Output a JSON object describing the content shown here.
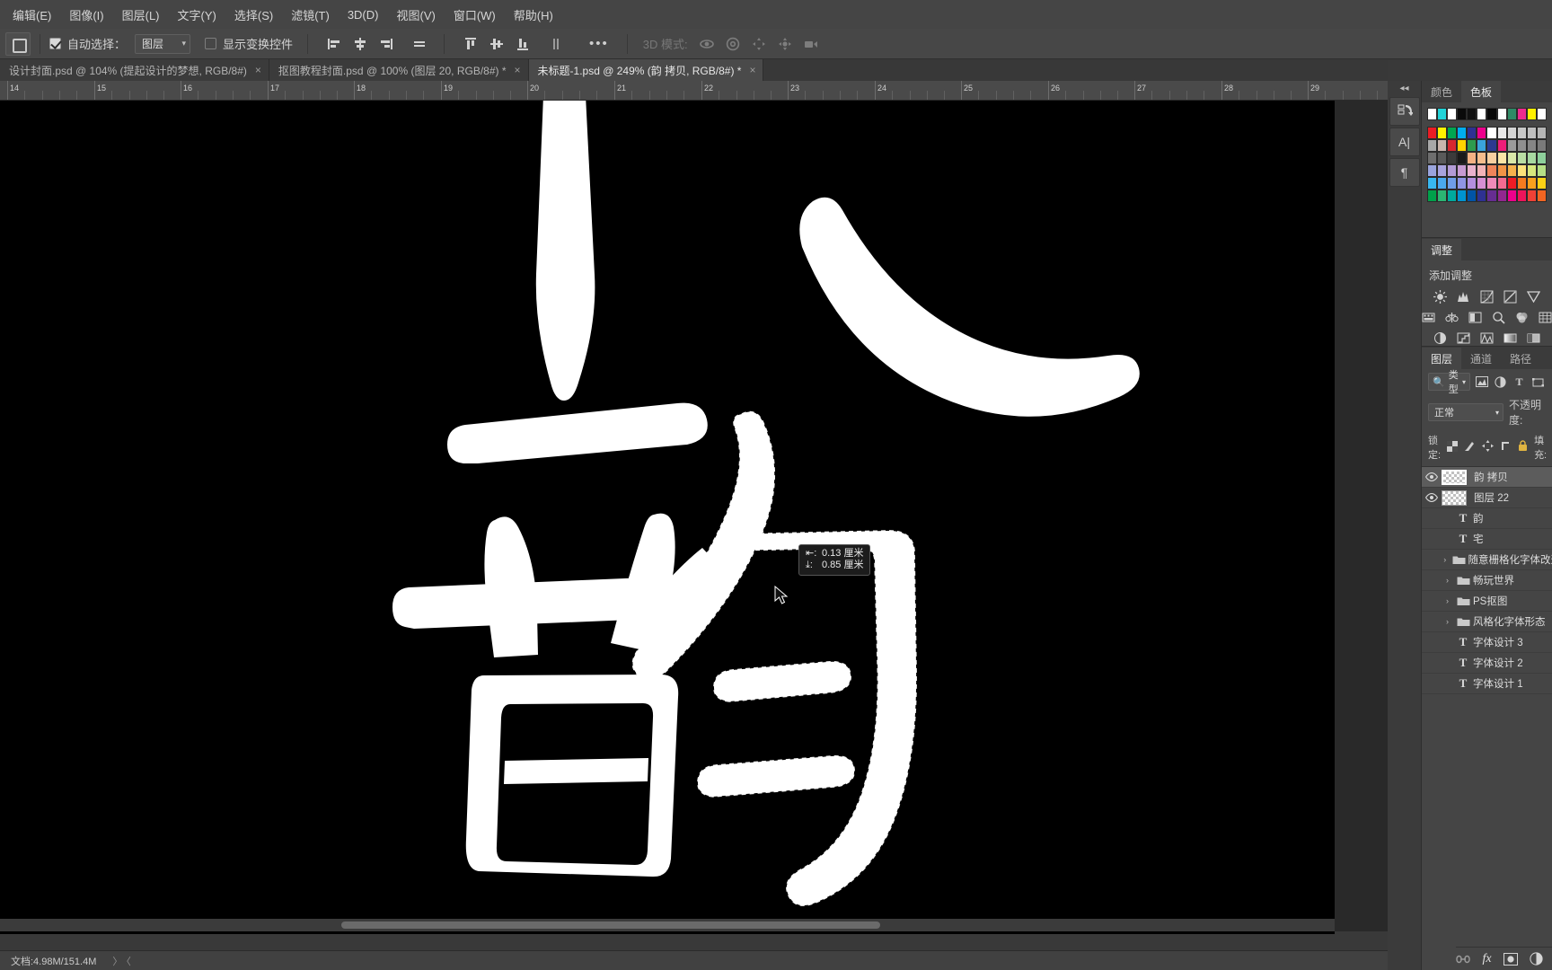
{
  "menubar": {
    "items": [
      {
        "label": "编辑(E)"
      },
      {
        "label": "图像(I)"
      },
      {
        "label": "图层(L)"
      },
      {
        "label": "文字(Y)"
      },
      {
        "label": "选择(S)"
      },
      {
        "label": "滤镜(T)"
      },
      {
        "label": "3D(D)"
      },
      {
        "label": "视图(V)"
      },
      {
        "label": "窗口(W)"
      },
      {
        "label": "帮助(H)"
      }
    ]
  },
  "options": {
    "tool_icon": "move-tool-icon",
    "auto_select_label": "自动选择：",
    "auto_select_checked": true,
    "auto_select_value": "图层",
    "show_transform_label": "显示变换控件",
    "show_transform_checked": false,
    "align_icons": [
      "align-left-edges-icon",
      "align-horizontal-centers-icon",
      "align-right-edges-icon",
      "distribute-horizontal-icon"
    ],
    "distribute_icons": [
      "align-top-edges-icon",
      "align-vertical-centers-icon",
      "align-bottom-edges-icon",
      "distribute-vertical-icon"
    ],
    "more_label": "•••",
    "mode3d_label": "3D 模式:",
    "mode3d_icons": [
      "3d-orbit-icon",
      "3d-roll-icon",
      "3d-pan-icon",
      "3d-slide-icon",
      "3d-camera-icon"
    ]
  },
  "tabs": [
    {
      "label": "设计封面.psd @ 104% (提起设计的梦想, RGB/8#)",
      "active": false,
      "close": "×"
    },
    {
      "label": "抠图教程封面.psd @ 100% (图层 20, RGB/8#) *",
      "active": false,
      "close": "×"
    },
    {
      "label": "未标题-1.psd @ 249% (韵 拷贝, RGB/8#) *",
      "active": true,
      "close": "×"
    }
  ],
  "ruler": {
    "unit_marks": [
      "14",
      "15",
      "16",
      "17",
      "18",
      "19",
      "20",
      "21",
      "22",
      "23",
      "24",
      "25",
      "26",
      "27",
      "28",
      "29"
    ]
  },
  "canvas": {
    "document_character": "韵",
    "zoom": "249%",
    "measure_tooltip": {
      "horizontal_icon": "horizontal-distance-icon",
      "horizontal_value": "0.13 厘米",
      "vertical_icon": "vertical-distance-icon",
      "vertical_value": "0.85 厘米"
    }
  },
  "statusbar": {
    "doc_label": "文档:4.98M/151.4M",
    "arrows": "〉〈"
  },
  "right_rail": {
    "collapse_icon": "collapse-panels-icon",
    "buttons": [
      {
        "icon": "history-icon"
      },
      {
        "icon": "character-panel-icon",
        "glyph": "A|"
      },
      {
        "icon": "paragraph-panel-icon",
        "glyph": "¶"
      }
    ]
  },
  "color_panel": {
    "tabs": [
      {
        "label": "颜色",
        "active": false
      },
      {
        "label": "色板",
        "active": true
      }
    ],
    "swatch_rows": [
      [
        "#ffffff",
        "#22d3d8",
        "#ffffff",
        "#0a0a0a",
        "#111111",
        "#ffffff",
        "#080808",
        "#fdfdfd",
        "#2f8a66",
        "#ee2a8f",
        "#fff000",
        "#ffffff"
      ],
      [
        "#ec1c24",
        "#fff200",
        "#00a651",
        "#00aeef",
        "#2e3192",
        "#ec008c",
        "#ffffff",
        "#e8e8e8",
        "#d4d4d4",
        "#c8c8c8",
        "#bfbfbf",
        "#b5b5b5"
      ],
      [
        "#a8a8a8",
        "#c9b5ad",
        "#d7282f",
        "#ffd400",
        "#2e9b4e",
        "#3aa3db",
        "#2b3990",
        "#ed1e79",
        "#9b9b9b",
        "#8f8f8f",
        "#858585",
        "#7a7a7a"
      ],
      [
        "#6e6e6e",
        "#5a5a5a",
        "#3b3b3b",
        "#1a1a1a",
        "#f4b183",
        "#f6bd8d",
        "#f8cfa0",
        "#fbe5a6",
        "#d9e8a8",
        "#b9dea3",
        "#a7d8a0",
        "#8ecf9b"
      ],
      [
        "#9aa4dd",
        "#a8a3dd",
        "#b39bd6",
        "#c79bd2",
        "#e9b2cd",
        "#f2b3b8",
        "#f0845a",
        "#f29446",
        "#f5b14c",
        "#fce27a",
        "#d7e77d",
        "#b6df86"
      ],
      [
        "#38b7f0",
        "#4aa8ee",
        "#6f9ee8",
        "#8f95e3",
        "#b48fdd",
        "#d58fd2",
        "#ef8ab9",
        "#f36b91",
        "#ee1c25",
        "#f47b20",
        "#f8a01e",
        "#fcd116"
      ],
      [
        "#00a14b",
        "#2bb673",
        "#00a99d",
        "#0093d0",
        "#0054a6",
        "#2e3192",
        "#662d91",
        "#92278f",
        "#ec008c",
        "#ed145b",
        "#ef4136",
        "#f26522"
      ]
    ]
  },
  "adjust_panel": {
    "tab_label": "调整",
    "add_label": "添加调整",
    "icon_rows": [
      [
        "brightness-contrast-icon",
        "levels-icon",
        "curves-icon",
        "exposure-icon",
        "vibrance-icon"
      ],
      [
        "hue-saturation-icon",
        "color-balance-icon",
        "black-white-icon",
        "photo-filter-icon",
        "channel-mixer-icon",
        "color-lookup-icon"
      ],
      [
        "invert-icon",
        "posterize-icon",
        "threshold-icon",
        "gradient-map-icon",
        "selective-color-icon"
      ]
    ]
  },
  "layers_panel": {
    "tabs": [
      {
        "label": "图层",
        "active": true
      },
      {
        "label": "通道",
        "active": false
      },
      {
        "label": "路径",
        "active": false
      }
    ],
    "filter": {
      "search_icon": "search-icon",
      "type_label": "类型",
      "kind_icons": [
        "filter-pixel-icon",
        "filter-adjustment-icon",
        "filter-type-icon",
        "filter-shape-icon"
      ]
    },
    "blend_mode": "正常",
    "opacity_label": "不透明度:",
    "lock_label": "锁定:",
    "lock_icons": [
      "lock-transparent-icon",
      "lock-image-icon",
      "lock-position-icon",
      "lock-artboard-icon",
      "lock-all-icon"
    ],
    "fill_label": "填充:",
    "layers": [
      {
        "name": "韵 拷贝",
        "type": "pixel",
        "visible": true,
        "selected": true
      },
      {
        "name": "图层 22",
        "type": "pixel",
        "visible": true,
        "selected": false
      },
      {
        "name": "韵",
        "type": "text",
        "visible": false,
        "selected": false
      },
      {
        "name": "宅",
        "type": "text",
        "visible": false,
        "selected": false
      },
      {
        "name": "随意栅格化字体改造",
        "type": "group",
        "visible": false,
        "selected": false
      },
      {
        "name": "畅玩世界",
        "type": "group",
        "visible": false,
        "selected": false
      },
      {
        "name": "PS抠图",
        "type": "group",
        "visible": false,
        "selected": false
      },
      {
        "name": "风格化字体形态",
        "type": "group",
        "visible": false,
        "selected": false
      },
      {
        "name": "字体设计 3",
        "type": "text",
        "visible": false,
        "selected": false
      },
      {
        "name": "字体设计 2",
        "type": "text",
        "visible": false,
        "selected": false
      },
      {
        "name": "字体设计 1",
        "type": "text",
        "visible": false,
        "selected": false
      }
    ],
    "footer_icons": [
      "link-layers-icon",
      "layer-style-fx-icon",
      "layer-mask-icon",
      "new-adjustment-icon"
    ]
  },
  "colors": {
    "chrome": "#454545",
    "panel": "#3b3b3b",
    "canvas_bg": "#000000",
    "artwork": "#ffffff",
    "selected_row": "#5c5c5c"
  }
}
